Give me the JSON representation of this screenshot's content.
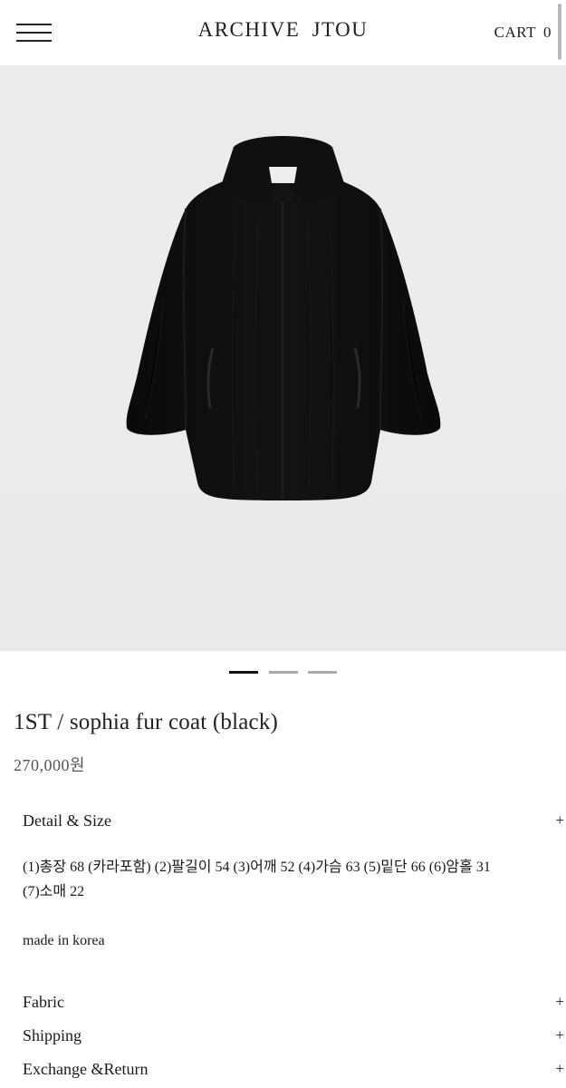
{
  "header": {
    "logo": "ARCHIVE JTOU",
    "cart_label": "CART",
    "cart_count": "0"
  },
  "product_image": {
    "subject": "black fur coat",
    "background": "#ebebeb",
    "coat_color": "#0d0d0d",
    "slide_count": 3,
    "active_slide": 1
  },
  "product": {
    "title": "1ST / sophia fur coat (black)",
    "price": "270,000원"
  },
  "sections": {
    "detail": {
      "label": "Detail & Size",
      "toggle": "+",
      "line1": "(1)총장 68 (카라포함) (2)팔길이 54 (3)어깨 52 (4)가슴 63 (5)밑단 66 (6)암홀 31",
      "line2": "(7)소매 22",
      "origin": "made in korea"
    },
    "fabric": {
      "label": "Fabric",
      "toggle": "+"
    },
    "shipping": {
      "label": "Shipping",
      "toggle": "+"
    },
    "exchange": {
      "label": "Exchange &Return",
      "toggle": "+"
    }
  }
}
